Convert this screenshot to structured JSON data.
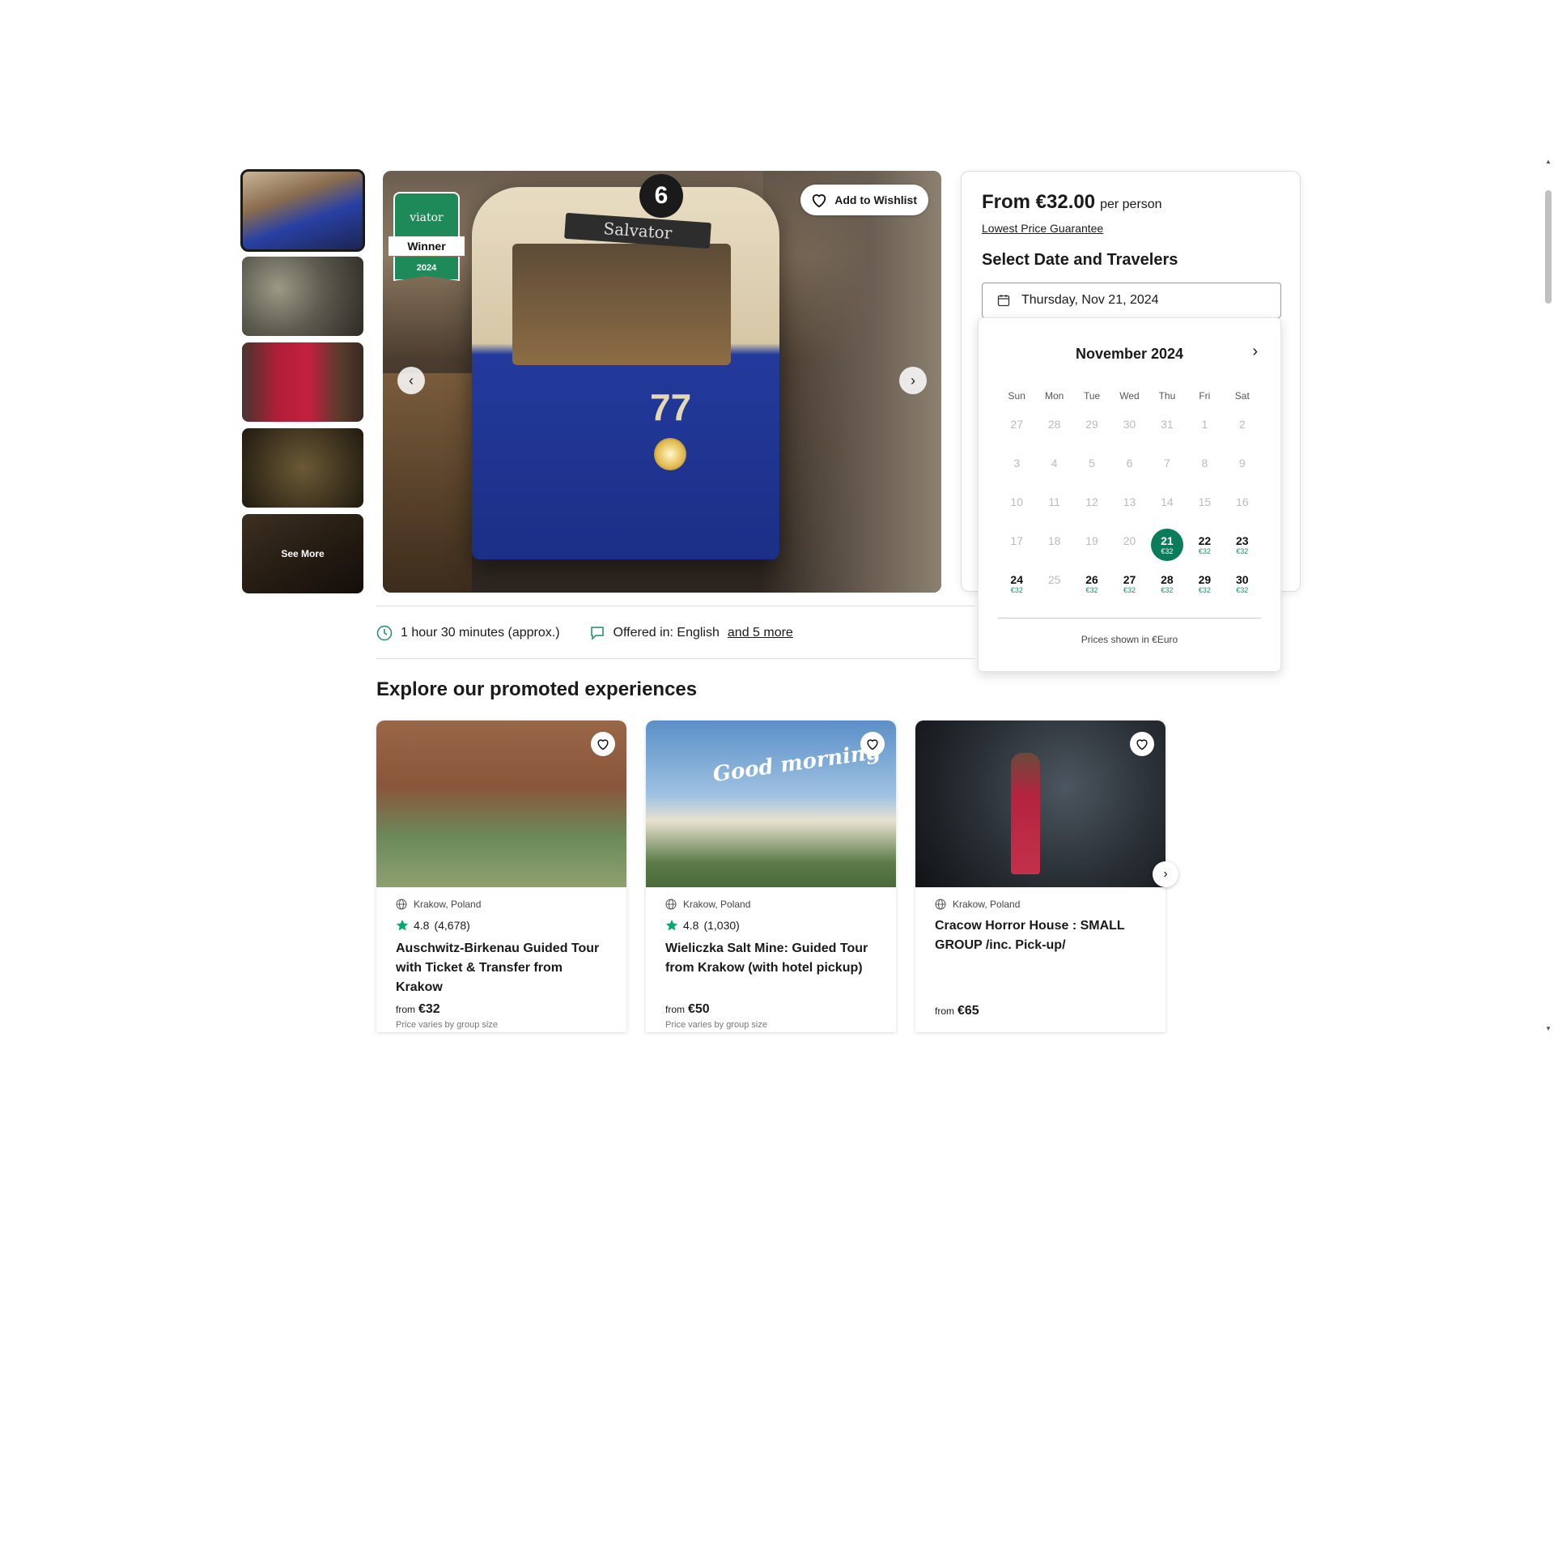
{
  "gallery": {
    "see_more": "See More",
    "award": {
      "brand": "viator",
      "label": "Winner",
      "year": "2024"
    },
    "tram_sign": "Salvator",
    "tram_number": "77",
    "tram_route": "6",
    "wishlist_label": "Add to Wishlist"
  },
  "booking": {
    "price": "From €32.00",
    "per_person": "per person",
    "guarantee": "Lowest Price Guarantee",
    "select_title": "Select Date and Travelers",
    "date_value": "Thursday, Nov 21, 2024"
  },
  "calendar": {
    "month": "November 2024",
    "weekdays": [
      "Sun",
      "Mon",
      "Tue",
      "Wed",
      "Thu",
      "Fri",
      "Sat"
    ],
    "days": [
      {
        "n": "27",
        "p": ""
      },
      {
        "n": "28",
        "p": ""
      },
      {
        "n": "29",
        "p": ""
      },
      {
        "n": "30",
        "p": ""
      },
      {
        "n": "31",
        "p": ""
      },
      {
        "n": "1",
        "p": ""
      },
      {
        "n": "2",
        "p": ""
      },
      {
        "n": "3",
        "p": ""
      },
      {
        "n": "4",
        "p": ""
      },
      {
        "n": "5",
        "p": ""
      },
      {
        "n": "6",
        "p": ""
      },
      {
        "n": "7",
        "p": ""
      },
      {
        "n": "8",
        "p": ""
      },
      {
        "n": "9",
        "p": ""
      },
      {
        "n": "10",
        "p": ""
      },
      {
        "n": "11",
        "p": ""
      },
      {
        "n": "12",
        "p": ""
      },
      {
        "n": "13",
        "p": ""
      },
      {
        "n": "14",
        "p": ""
      },
      {
        "n": "15",
        "p": ""
      },
      {
        "n": "16",
        "p": ""
      },
      {
        "n": "17",
        "p": ""
      },
      {
        "n": "18",
        "p": ""
      },
      {
        "n": "19",
        "p": ""
      },
      {
        "n": "20",
        "p": ""
      },
      {
        "n": "21",
        "p": "€32",
        "selected": true
      },
      {
        "n": "22",
        "p": "€32"
      },
      {
        "n": "23",
        "p": "€32"
      },
      {
        "n": "24",
        "p": "€32"
      },
      {
        "n": "25",
        "p": ""
      },
      {
        "n": "26",
        "p": "€32"
      },
      {
        "n": "27",
        "p": "€32"
      },
      {
        "n": "28",
        "p": "€32"
      },
      {
        "n": "29",
        "p": "€32"
      },
      {
        "n": "30",
        "p": "€32"
      }
    ],
    "footer": "Prices shown in €Euro"
  },
  "info": {
    "duration": "1 hour 30 minutes (approx.)",
    "offered_in": "Offered in: English",
    "more_languages": "and 5 more"
  },
  "promoted": {
    "title": "Explore our promoted experiences",
    "cards": [
      {
        "location": "Krakow, Poland",
        "rating": "4.8",
        "reviews": "(4,678)",
        "title": "Auschwitz-Birkenau Guided Tour with Ticket & Transfer from Krakow",
        "from": "from",
        "price": "€32",
        "note": "Price varies by group size"
      },
      {
        "location": "Krakow, Poland",
        "rating": "4.8",
        "reviews": "(1,030)",
        "title": "Wieliczka Salt Mine: Guided Tour from Krakow (with hotel pickup)",
        "from": "from",
        "price": "€50",
        "note": "Price varies by group size",
        "overlay_text": "Good morning"
      },
      {
        "location": "Krakow, Poland",
        "title": "Cracow Horror House : SMALL GROUP /inc. Pick-up/",
        "from": "from",
        "price": "€65"
      }
    ]
  },
  "colors": {
    "accent": "#0a7c5a",
    "rating_star": "#00aa6c"
  }
}
